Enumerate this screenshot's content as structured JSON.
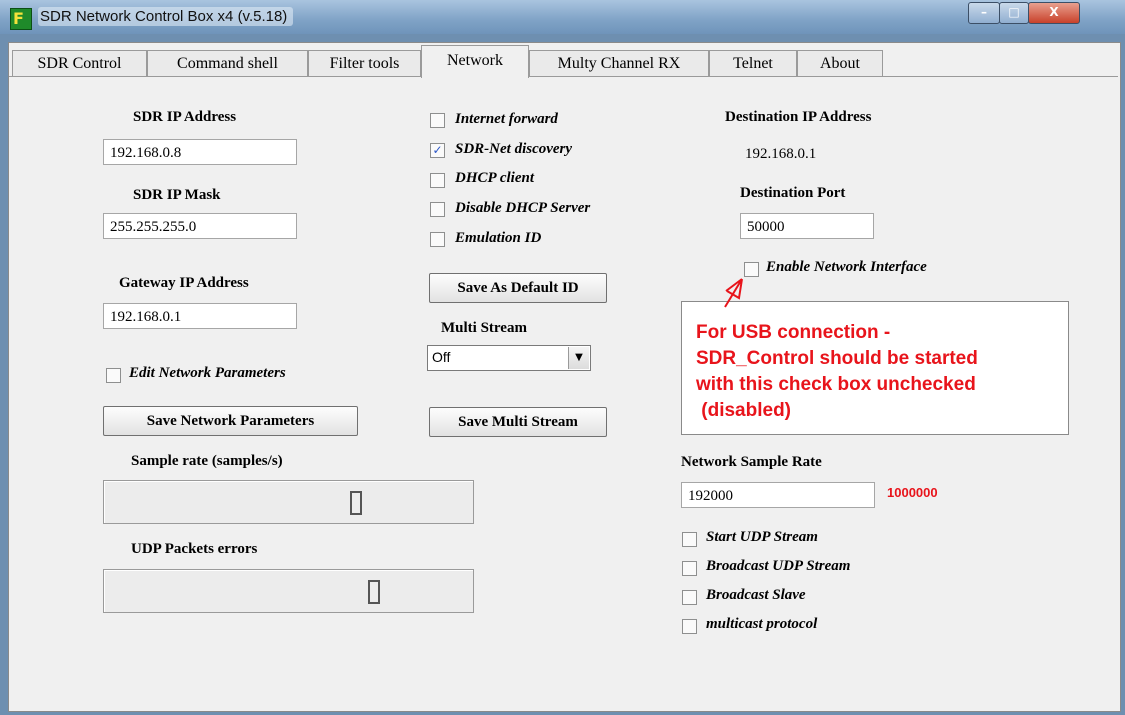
{
  "window": {
    "title": "SDR Network Control Box x4 (v.5.18)",
    "controls": {
      "minimize": "–",
      "maximize": "□",
      "close": "X"
    }
  },
  "tabs": [
    {
      "label": "SDR Control"
    },
    {
      "label": "Command shell"
    },
    {
      "label": "Filter tools"
    },
    {
      "label": "Network"
    },
    {
      "label": "Multy Channel RX"
    },
    {
      "label": "Telnet"
    },
    {
      "label": "About"
    }
  ],
  "active_tab": "Network",
  "network": {
    "sdr_ip_label": "SDR IP Address",
    "sdr_ip": "192.168.0.8",
    "sdr_mask_label": "SDR IP Mask",
    "sdr_mask": "255.255.255.0",
    "gateway_label": "Gateway IP Address",
    "gateway": "192.168.0.1",
    "edit_params_label": "Edit Network Parameters",
    "edit_params_checked": false,
    "save_params_label": "Save Network Parameters",
    "sample_rate_label": "Sample rate (samples/s)",
    "sample_rate_value": 0,
    "udp_errors_label": "UDP Packets errors",
    "udp_errors_value": 0
  },
  "options": {
    "internet_forward": {
      "label": "Internet forward",
      "checked": false
    },
    "sdr_net_discovery": {
      "label": "SDR-Net discovery",
      "checked": true
    },
    "dhcp_client": {
      "label": "DHCP client",
      "checked": false
    },
    "disable_dhcp_server": {
      "label": "Disable DHCP Server",
      "checked": false
    },
    "emulation_id": {
      "label": "Emulation ID",
      "checked": false
    },
    "save_default_id_label": "Save As Default ID",
    "multi_stream_label": "Multi Stream",
    "multi_stream_value": "Off",
    "save_multi_stream_label": "Save Multi Stream"
  },
  "destination": {
    "ip_label": "Destination IP Address",
    "ip": "192.168.0.1",
    "port_label": "Destination Port",
    "port": "50000",
    "enable_interface_label": "Enable Network Interface",
    "enable_interface_checked": false,
    "note": "For USB connection -\nSDR_Control should be started\nwith this check box unchecked\n (disabled)",
    "note_color": "#e8141b",
    "sample_rate_label": "Network Sample Rate",
    "sample_rate": "192000",
    "sample_rate_actual": "1000000",
    "start_udp": {
      "label": "Start UDP Stream",
      "checked": false
    },
    "broadcast_udp": {
      "label": "Broadcast UDP Stream",
      "checked": false
    },
    "broadcast_slave": {
      "label": "Broadcast Slave",
      "checked": false
    },
    "multicast": {
      "label": "multicast protocol",
      "checked": false
    }
  }
}
